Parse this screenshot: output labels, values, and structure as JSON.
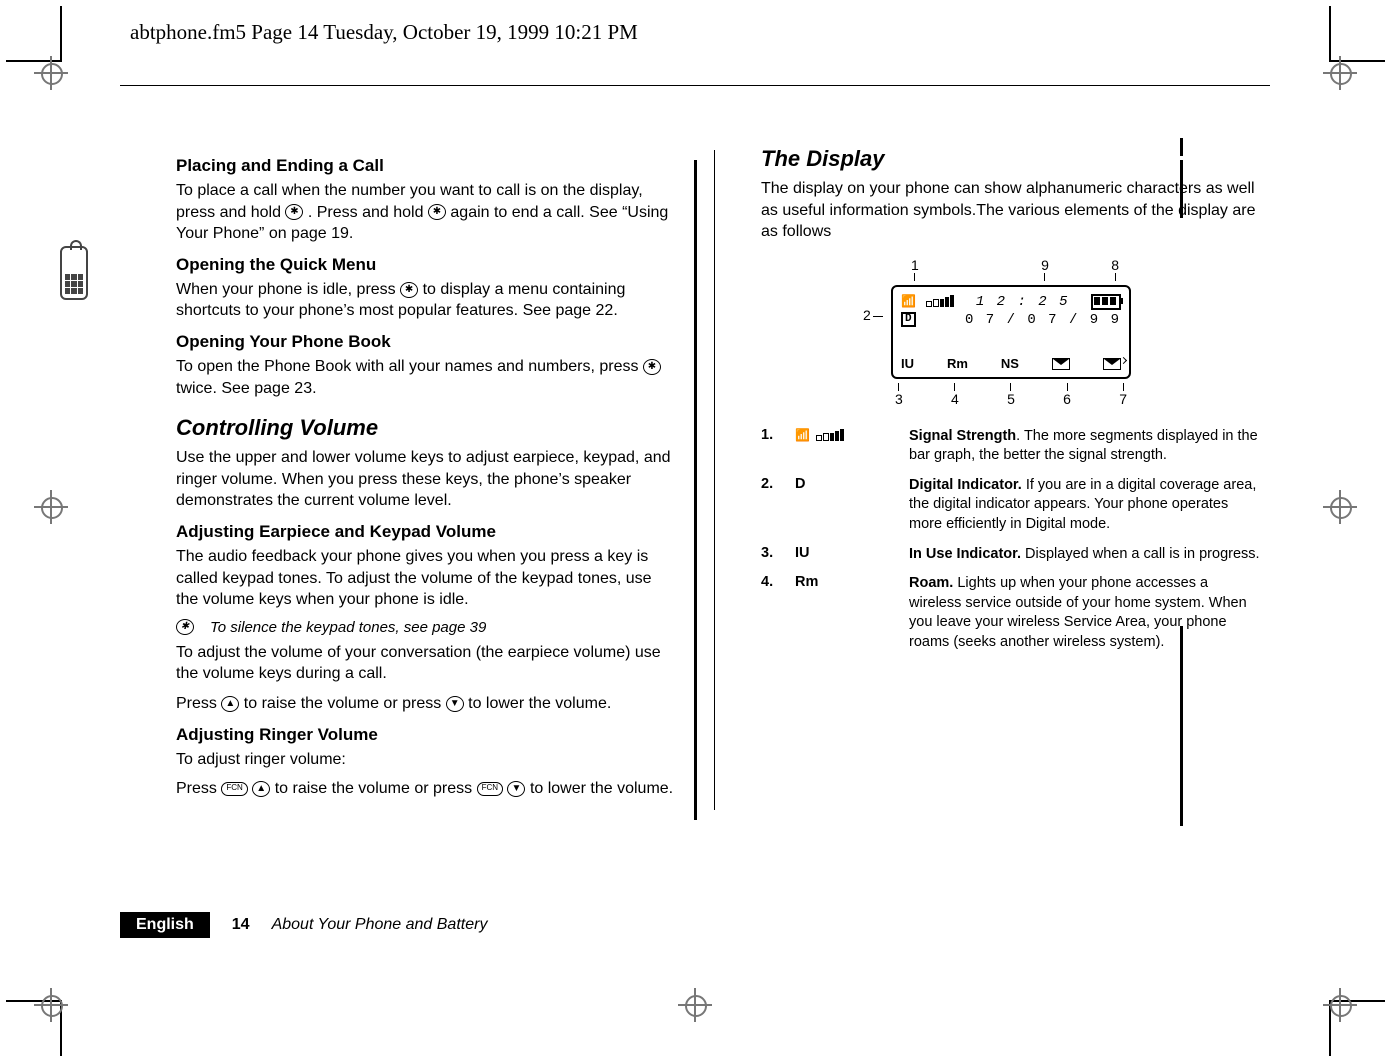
{
  "running_head": "abtphone.fm5  Page 14  Tuesday, October 19, 1999  10:21 PM",
  "left": {
    "s1_title": "Placing and Ending a Call",
    "s1_body_a": "To place a call when the number you want to call is on the display, press and hold ",
    "s1_body_b": ". Press and hold ",
    "s1_body_c": " again to end a call. See “Using Your Phone” on page 19.",
    "s2_title": "Opening the Quick Menu",
    "s2_body_a": "When your phone is idle, press ",
    "s2_body_b": " to display a menu containing shortcuts to your phone’s most popular features. See page 22.",
    "s3_title": "Opening Your Phone Book",
    "s3_body_a": "To open the Phone Book with all your names and numbers, press ",
    "s3_body_b": " twice. See page 23.",
    "sec_ctrl_title": "Controlling Volume",
    "sec_ctrl_body": "Use the upper and lower volume keys to adjust earpiece, keypad, and ringer volume. When you press these keys, the phone’s speaker demonstrates the current volume level.",
    "s4_title": "Adjusting Earpiece and Keypad Volume",
    "s4_body1": "The audio feedback your phone gives you when you press a key is called keypad tones. To adjust the volume of the keypad tones, use the volume keys when your phone is idle.",
    "tip_text": "To silence the keypad tones, see page 39",
    "s4_body2": "To adjust the volume of your conversation (the earpiece volume) use the volume keys during a call.",
    "s4_body3_a": "Press ",
    "s4_body3_b": " to raise the volume or press ",
    "s4_body3_c": " to lower the volume.",
    "s5_title": "Adjusting Ringer Volume",
    "s5_body1": "To adjust ringer volume:",
    "s5_body2_a": "Press ",
    "s5_body2_b": " to raise the volume or press ",
    "s5_body2_c": " to lower the volume.",
    "fcn_label": "FCN"
  },
  "right": {
    "title": "The Display",
    "intro": "The display on your phone can show alphanumeric characters as well as useful information symbols.The various elements of the display are as follows",
    "display": {
      "time": "1 2 : 2 5",
      "date": "0 7 / 0 7 / 9 9",
      "iu": "IU",
      "rm": "Rm",
      "ns": "NS",
      "d": "D"
    },
    "callouts": {
      "c1": "1",
      "c2": "2",
      "c3": "3",
      "c4": "4",
      "c5": "5",
      "c6": "6",
      "c7": "7",
      "c8": "8",
      "c9": "9"
    },
    "legend": [
      {
        "num": "1.",
        "sym_type": "signal",
        "desc_strong": "Signal Strength",
        "desc_rest": ". The more segments displayed in the bar graph, the better the signal strength."
      },
      {
        "num": "2.",
        "sym": "D",
        "desc_strong": "Digital Indicator.",
        "desc_rest": " If you are in a digital coverage area, the digital indicator appears. Your phone operates more efficiently in Digital mode."
      },
      {
        "num": "3.",
        "sym": "IU",
        "desc_strong": "In Use Indicator.",
        "desc_rest": " Displayed when a call is in progress."
      },
      {
        "num": "4.",
        "sym": "Rm",
        "desc_strong": "Roam.",
        "desc_rest": " Lights up when your phone accesses a wireless service outside of your home system. When you leave your wireless Service Area, your phone roams (seeks another wireless system)."
      }
    ]
  },
  "footer": {
    "lang": "English",
    "page_num": "14",
    "title": "About Your Phone and Battery"
  }
}
